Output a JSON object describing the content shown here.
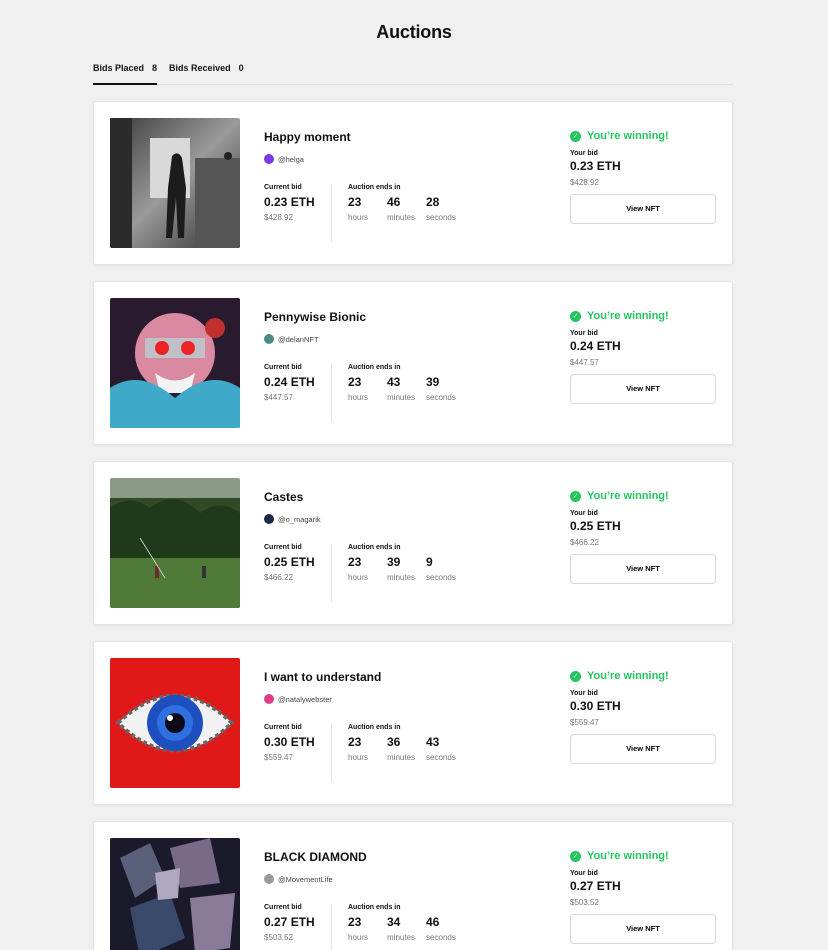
{
  "page_title": "Auctions",
  "tabs": [
    {
      "label": "Bids Placed",
      "count": "8"
    },
    {
      "label": "Bids Received",
      "count": "0"
    }
  ],
  "labels": {
    "current_bid": "Current bid",
    "auction_ends": "Auction ends in",
    "hours": "hours",
    "minutes": "minutes",
    "seconds": "seconds",
    "winning": "You’re winning!",
    "your_bid": "Your bid",
    "view_nft": "View NFT"
  },
  "colors": {
    "accent_green": "#22c55e"
  },
  "auctions": [
    {
      "title": "Happy moment",
      "creator": "@helga",
      "current_bid": "0.23 ETH",
      "current_usd": "$428.92",
      "hours": "23",
      "minutes": "46",
      "seconds": "28",
      "your_bid": "0.23 ETH",
      "your_usd": "$428.92"
    },
    {
      "title": "Pennywise Bionic",
      "creator": "@delanNFT",
      "current_bid": "0.24 ETH",
      "current_usd": "$447.57",
      "hours": "23",
      "minutes": "43",
      "seconds": "39",
      "your_bid": "0.24 ETH",
      "your_usd": "$447.57"
    },
    {
      "title": "Castes",
      "creator": "@o_magarik",
      "current_bid": "0.25 ETH",
      "current_usd": "$466.22",
      "hours": "23",
      "minutes": "39",
      "seconds": "9",
      "your_bid": "0.25 ETH",
      "your_usd": "$466.22"
    },
    {
      "title": "I want to understand",
      "creator": "@natalywebster",
      "current_bid": "0.30 ETH",
      "current_usd": "$559.47",
      "hours": "23",
      "minutes": "36",
      "seconds": "43",
      "your_bid": "0.30 ETH",
      "your_usd": "$559.47"
    },
    {
      "title": "BLACK DIAMOND",
      "creator": "@MovementLife",
      "current_bid": "0.27 ETH",
      "current_usd": "$503.52",
      "hours": "23",
      "minutes": "34",
      "seconds": "46",
      "your_bid": "0.27 ETH",
      "your_usd": "$503.52"
    }
  ]
}
